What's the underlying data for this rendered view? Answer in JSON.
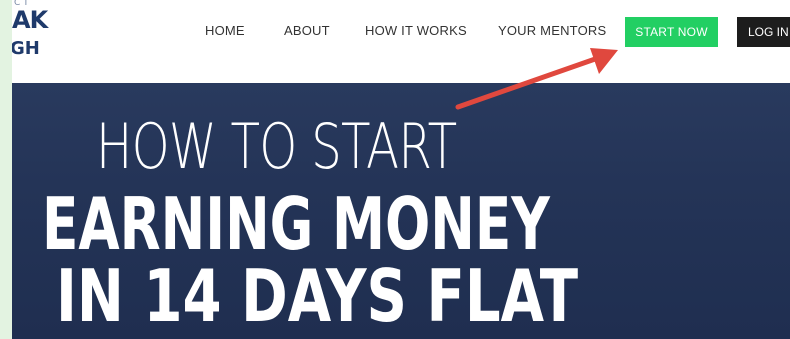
{
  "logo": {
    "top": "AK",
    "bottom": "GH",
    "tiny": "C T"
  },
  "nav": {
    "home": "HOME",
    "about": "ABOUT",
    "how": "HOW IT WORKS",
    "mentors": "YOUR MENTORS",
    "start": "START NOW",
    "login": "LOG IN"
  },
  "hero": {
    "line1": "HOW TO START",
    "line2": "EARNING MONEY",
    "line3": "IN 14 DAYS FLAT"
  },
  "colors": {
    "start_button": "#22cf63",
    "login_button": "#1d1d1d",
    "hero_background": "#243457",
    "annotation_arrow": "#e0483e"
  }
}
